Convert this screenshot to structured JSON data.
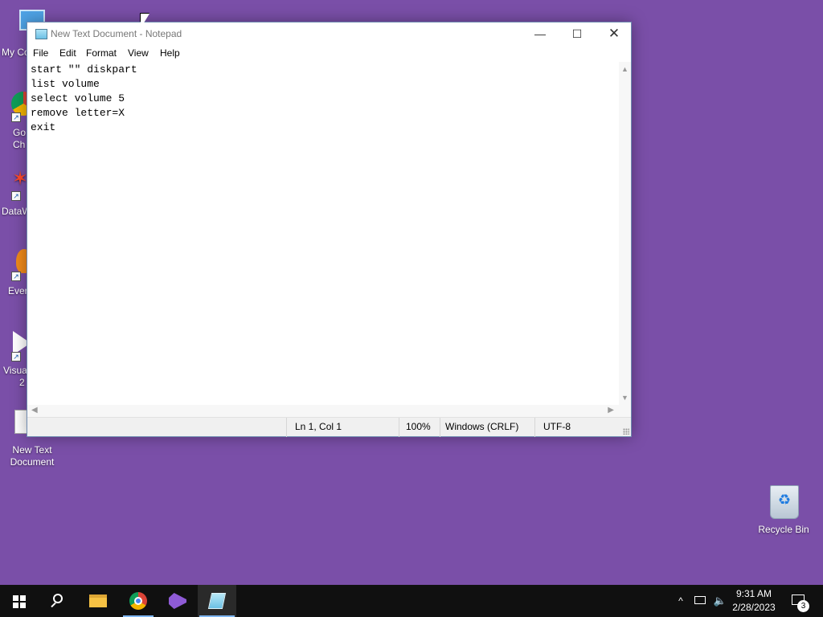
{
  "desktop": {
    "background": "#7a4fa8",
    "icons": {
      "this_pc": "My Co",
      "chrome_1": "Go",
      "chrome_2": "Ch",
      "datawrapper": "DataW",
      "evernote": "Ever",
      "visual_studio_1": "Visua",
      "visual_studio_2": "2",
      "new_text_document": "New Text\nDocument",
      "recycle_bin": "Recycle Bin"
    }
  },
  "window": {
    "title": "New Text Document - Notepad",
    "controls": {
      "minimize": "—",
      "maximize": "☐",
      "close": "✕"
    },
    "menu": [
      "File",
      "Edit",
      "Format",
      "View",
      "Help"
    ],
    "content": "start \"\" diskpart\nlist volume\nselect volume 5\nremove letter=X\nexit",
    "status": {
      "position": "Ln 1, Col 1",
      "zoom": "100%",
      "line_ending": "Windows (CRLF)",
      "encoding": "UTF-8"
    }
  },
  "taskbar": {
    "pinned": [
      "start-icon",
      "search-icon",
      "file-explorer-icon",
      "chrome-icon",
      "visual-studio-icon",
      "notepad-icon"
    ],
    "active_app": "Notepad",
    "tray": {
      "chevron": "^",
      "volume": "🔈",
      "time": "9:31 AM",
      "date": "2/28/2023",
      "notification_count": "3"
    }
  }
}
